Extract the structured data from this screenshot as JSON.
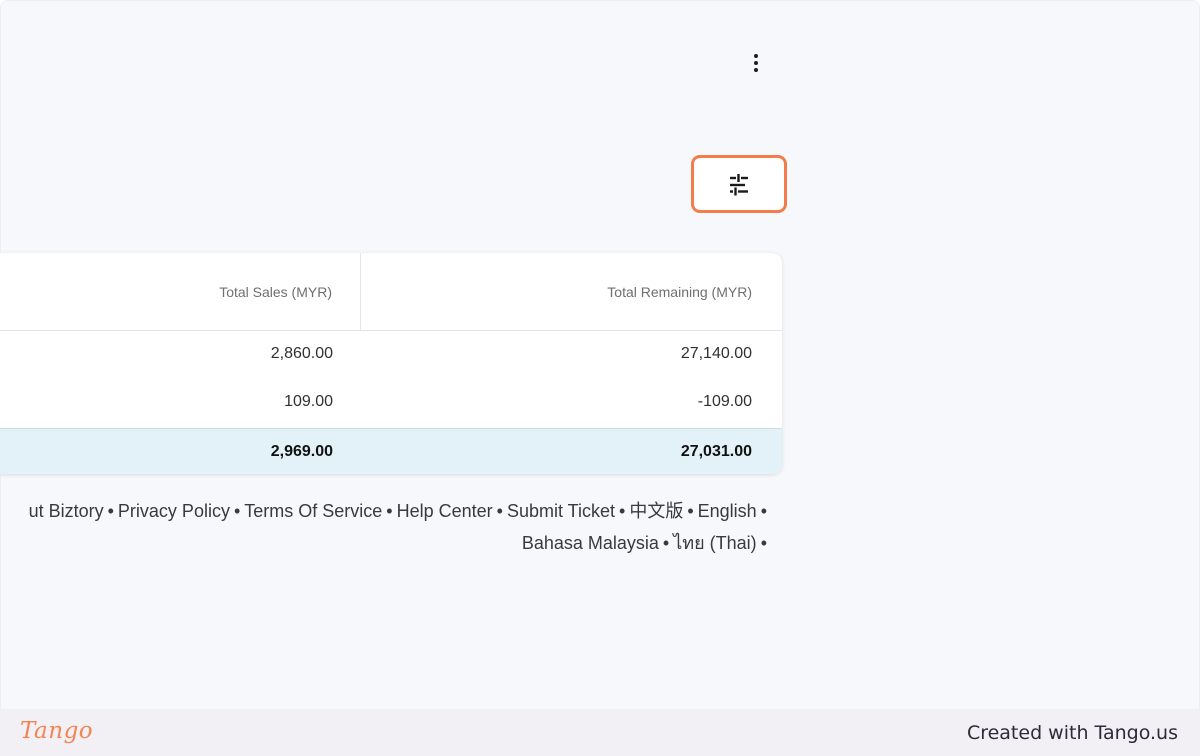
{
  "toolbar": {
    "more_icon": "more-vertical-icon",
    "filter_icon": "sliders-icon",
    "highlight_color": "#f27c4a"
  },
  "table": {
    "columns": [
      "Total Sales (MYR)",
      "Total Remaining (MYR)"
    ],
    "rows": [
      {
        "total_sales": "2,860.00",
        "total_remaining": "27,140.00"
      },
      {
        "total_sales": "109.00",
        "total_remaining": "-109.00"
      }
    ],
    "totals": {
      "total_sales": "2,969.00",
      "total_remaining": "27,031.00"
    }
  },
  "footer": {
    "line1_links": [
      "ut Biztory",
      "Privacy Policy",
      "Terms Of Service",
      "Help Center",
      "Submit Ticket",
      "中文版",
      "English"
    ],
    "line2_links": [
      "Bahasa Malaysia",
      "ไทย (Thai)"
    ],
    "separator": "•"
  },
  "tango": {
    "logo_text": "Tango",
    "created_text": "Created with Tango.us",
    "brand_color": "#f28552"
  }
}
